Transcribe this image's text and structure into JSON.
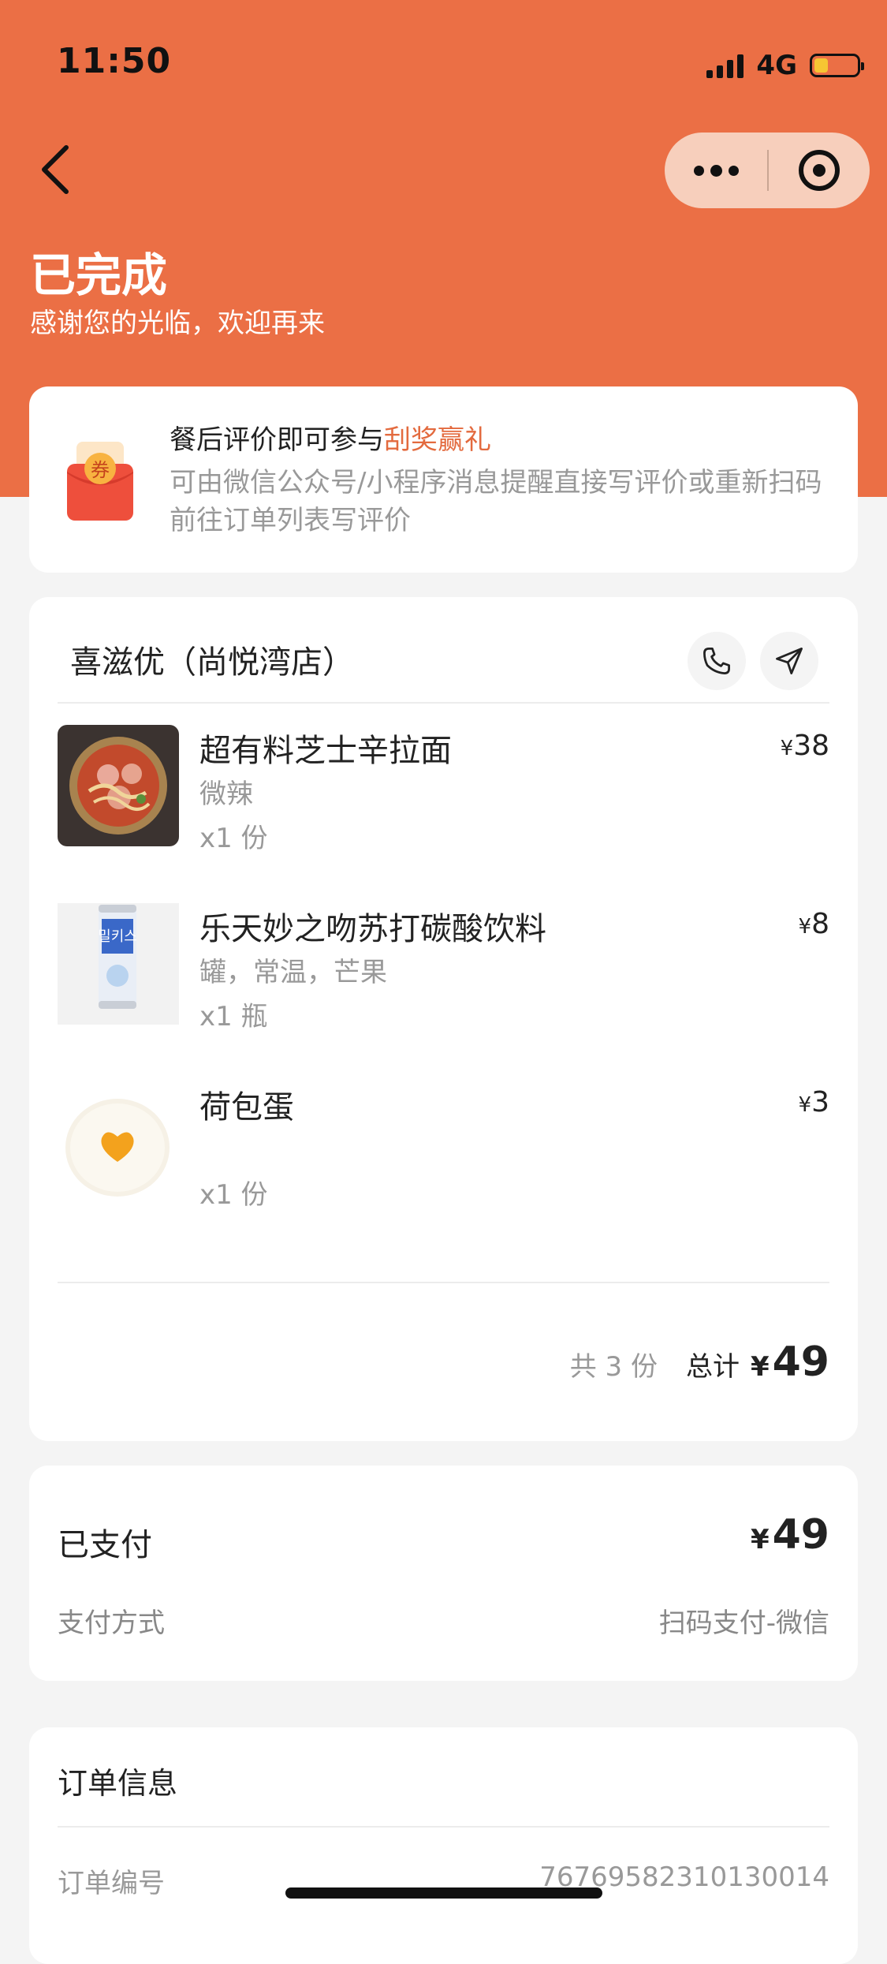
{
  "status_bar": {
    "time": "11:50",
    "network": "4G"
  },
  "header": {
    "title": "已完成",
    "subtitle": "感谢您的光临，欢迎再来",
    "back_icon": "chevron-left-icon",
    "more_icon": "more-dots-icon",
    "close_icon": "target-close-icon",
    "color": "#eb6f45"
  },
  "promo": {
    "title": "餐后评价即可参与",
    "highlight": "刮奖赢礼",
    "description": "可由微信公众号/小程序消息提醒直接写评价或重新扫码前往订单列表写评价",
    "icon_text": "券",
    "highlight_color": "#e36a3e"
  },
  "order": {
    "store_name": "喜滋优（尚悦湾店）",
    "phone_icon": "phone-icon",
    "nav_icon": "navigation-icon",
    "items": [
      {
        "name": "超有料芝士辛拉面",
        "spec": "微辣",
        "qty": "x1 份",
        "currency": "¥",
        "price": "38"
      },
      {
        "name": "乐天妙之吻苏打碳酸饮料",
        "spec": "罐，常温，芒果",
        "qty": "x1 瓶",
        "currency": "¥",
        "price": "8"
      },
      {
        "name": "荷包蛋",
        "spec": "",
        "qty": "x1 份",
        "currency": "¥",
        "price": "3"
      }
    ],
    "count_text": "共 3 份",
    "total_label": "总计",
    "total_currency": "¥",
    "total_amount": "49"
  },
  "payment": {
    "status": "已支付",
    "currency": "¥",
    "amount": "49",
    "method_label": "支付方式",
    "method": "扫码支付-微信"
  },
  "order_info": {
    "title": "订单信息",
    "number_label": "订单编号",
    "number": "76769582310130014"
  }
}
